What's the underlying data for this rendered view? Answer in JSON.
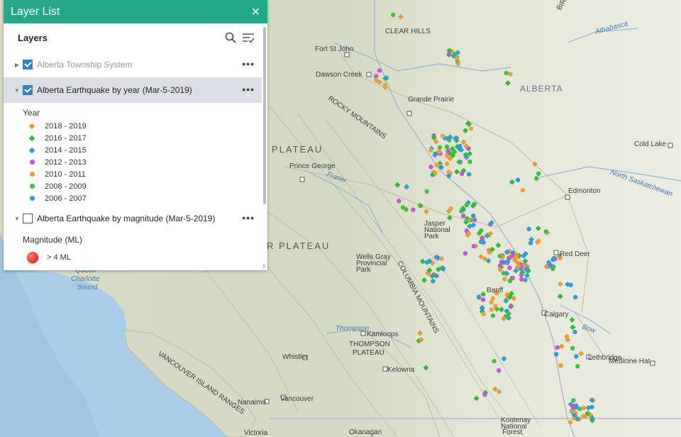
{
  "panel": {
    "title": "Layer List",
    "layers_heading": "Layers",
    "layers": [
      {
        "label": "Alberta Township System",
        "checked": true,
        "expanded": false,
        "muted": true
      },
      {
        "label": "Alberta Earthquake by year (Mar-5-2019)",
        "checked": true,
        "expanded": true,
        "selected": true
      },
      {
        "label": "Alberta Earthquake by magnitude (Mar-5-2019)",
        "checked": false,
        "expanded": true
      }
    ],
    "more_label": "•••",
    "year_legend": {
      "heading": "Year",
      "items": [
        {
          "label": "2018 - 2019",
          "shape": "diamond",
          "color": "#e89b3a"
        },
        {
          "label": "2016 - 2017",
          "shape": "diamond",
          "color": "#2fb83a"
        },
        {
          "label": "2014 - 2015",
          "shape": "diamond",
          "color": "#2f9ed4"
        },
        {
          "label": "2012 - 2013",
          "shape": "circle",
          "color": "#c654d8"
        },
        {
          "label": "2010 - 2011",
          "shape": "circle",
          "color": "#e8a23a"
        },
        {
          "label": "2008 - 2009",
          "shape": "circle",
          "color": "#3fbf3f"
        },
        {
          "label": "2006 - 2007",
          "shape": "circle",
          "color": "#2d9bd6"
        }
      ]
    },
    "magnitude_legend": {
      "heading": "Magnitude (ML)",
      "items": [
        {
          "label": "> 4 ML",
          "color": "#e02a1f"
        }
      ]
    }
  },
  "map_labels": {
    "cities": [
      "Fort St John",
      "Dawson Creek",
      "Grande Prairie",
      "Prince George",
      "Jasper National Park",
      "Wells Gray Provincial Park",
      "Kamloops",
      "Kelowna",
      "Whistler",
      "Vancouver",
      "Nanaimo",
      "Victoria",
      "Okanagan",
      "Edmonton",
      "Red Deer",
      "Calgary",
      "Banff",
      "Lethbridge",
      "Medicine Hat",
      "Cold Lake",
      "Kootenay National Park",
      "Forest"
    ],
    "regions": [
      "CLEAR HILLS",
      "ALBERTA",
      "PLATEAU",
      "R PLATEAU",
      "THOMPSON PLATEAU",
      "ROCKY MOUNTAINS",
      "COLUMBIA MOUNTAINS",
      "VANCOUVER ISLAND RANGES",
      "BIRCH"
    ],
    "water": [
      "Queen Charlotte Sound",
      "Athabasca",
      "North Saskatchewan",
      "Thompson",
      "Fraser",
      "Bow"
    ]
  }
}
